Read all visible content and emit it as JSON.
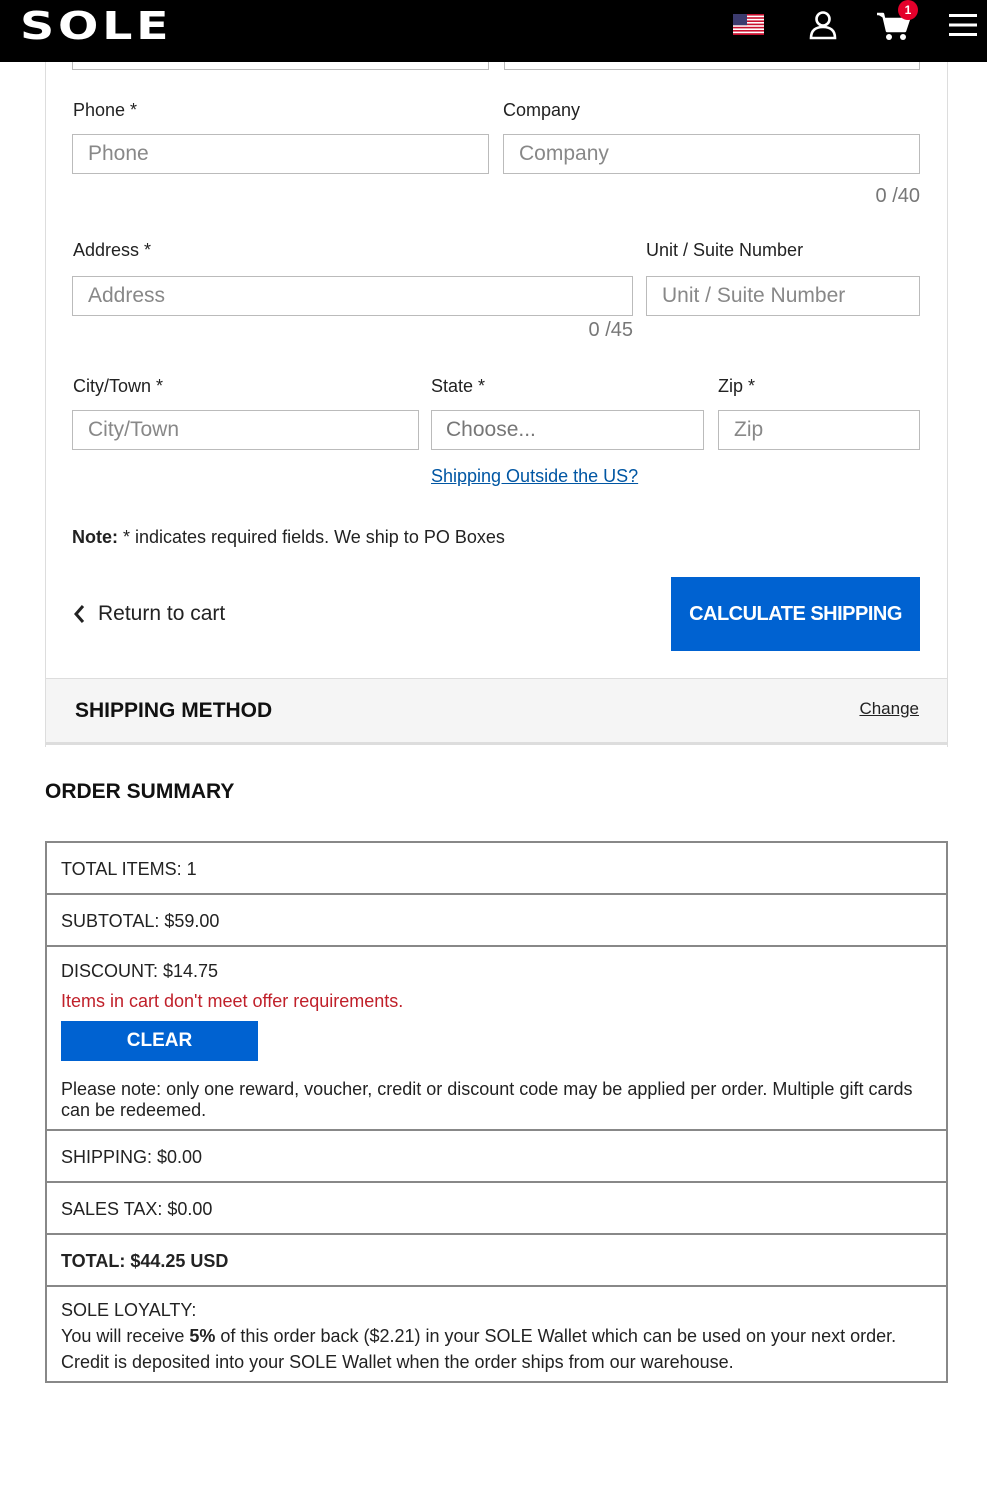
{
  "header": {
    "logo": "SOLE",
    "flag_icon": "us-flag-icon",
    "user_icon": "user-icon",
    "cart_icon": "cart-icon",
    "cart_count": "1",
    "menu_icon": "hamburger-menu-icon"
  },
  "form": {
    "phone_label": "Phone *",
    "phone_placeholder": "Phone",
    "company_label": "Company",
    "company_placeholder": "Company",
    "company_counter": "0 /40",
    "address_label": "Address *",
    "address_placeholder": "Address",
    "address_counter": "0 /45",
    "unit_label": "Unit / Suite Number",
    "unit_placeholder": "Unit / Suite Number",
    "city_label": "City/Town *",
    "city_placeholder": "City/Town",
    "state_label": "State *",
    "state_value": "Choose...",
    "zip_label": "Zip *",
    "zip_placeholder": "Zip",
    "outside_us_link": "Shipping Outside the US?",
    "note_bold": "Note:",
    "note_text": " * indicates required fields. We ship to PO Boxes",
    "return_label": "Return to cart",
    "calculate_label": "CALCULATE SHIPPING"
  },
  "shipping_method": {
    "title": "SHIPPING METHOD",
    "change_label": "Change"
  },
  "summary": {
    "title": "ORDER SUMMARY",
    "total_items": "TOTAL ITEMS: 1",
    "subtotal": "SUBTOTAL: $59.00",
    "discount": "DISCOUNT: $14.75",
    "discount_warning": "Items in cart don't meet offer requirements.",
    "clear_label": "CLEAR",
    "discount_note": "Please note: only one reward, voucher, credit or discount code may be applied per order. Multiple gift cards can be redeemed.",
    "shipping": "SHIPPING: $0.00",
    "sales_tax": "SALES TAX: $0.00",
    "total": "TOTAL: $44.25 USD",
    "loyalty_title": "SOLE LOYALTY:",
    "loyalty_pre": "You will receive ",
    "loyalty_percent": "5%",
    "loyalty_post": " of this order back ($2.21) in your SOLE Wallet which can be used on your next order.",
    "loyalty_line2": "Credit is deposited into your SOLE Wallet when the order ships from our warehouse."
  },
  "colors": {
    "primary_button": "#0062d1",
    "warning_text": "#c0202a",
    "link": "#0056a3",
    "header_bg": "#000000",
    "badge": "#e4002b"
  }
}
